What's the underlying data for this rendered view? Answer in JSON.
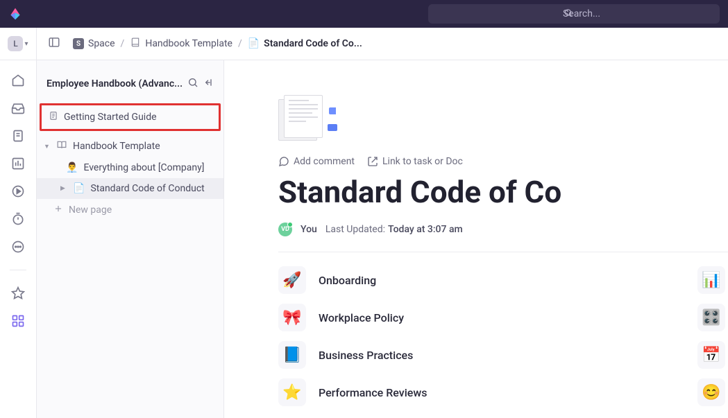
{
  "topbar": {
    "search_placeholder": "Search..."
  },
  "header": {
    "avatar_letter": "L",
    "breadcrumb": {
      "space": "Space",
      "template": "Handbook Template",
      "doc": "Standard Code of Co..."
    }
  },
  "sidebar": {
    "title": "Employee Handbook (Advanc...",
    "items": {
      "getting_started": "Getting Started Guide",
      "handbook_template": "Handbook Template",
      "company": "Everything about [Company]",
      "conduct": "Standard Code of Conduct",
      "new_page": "New page"
    }
  },
  "main": {
    "actions": {
      "add_comment": "Add comment",
      "link_task": "Link to task or Doc"
    },
    "title": "Standard Code of Co",
    "meta": {
      "badge": "VD",
      "you": "You",
      "updated_label": "Last Updated:",
      "updated_time": "Today at 3:07 am"
    },
    "sections": {
      "onboarding": {
        "icon": "🚀",
        "label": "Onboarding",
        "right": "📊"
      },
      "workplace": {
        "icon": "🎀",
        "label": "Workplace Policy",
        "right": "🎛️"
      },
      "business": {
        "icon": "📘",
        "label": "Business Practices",
        "right": "📅"
      },
      "reviews": {
        "icon": "⭐",
        "label": "Performance Reviews",
        "right": "😊"
      }
    }
  }
}
